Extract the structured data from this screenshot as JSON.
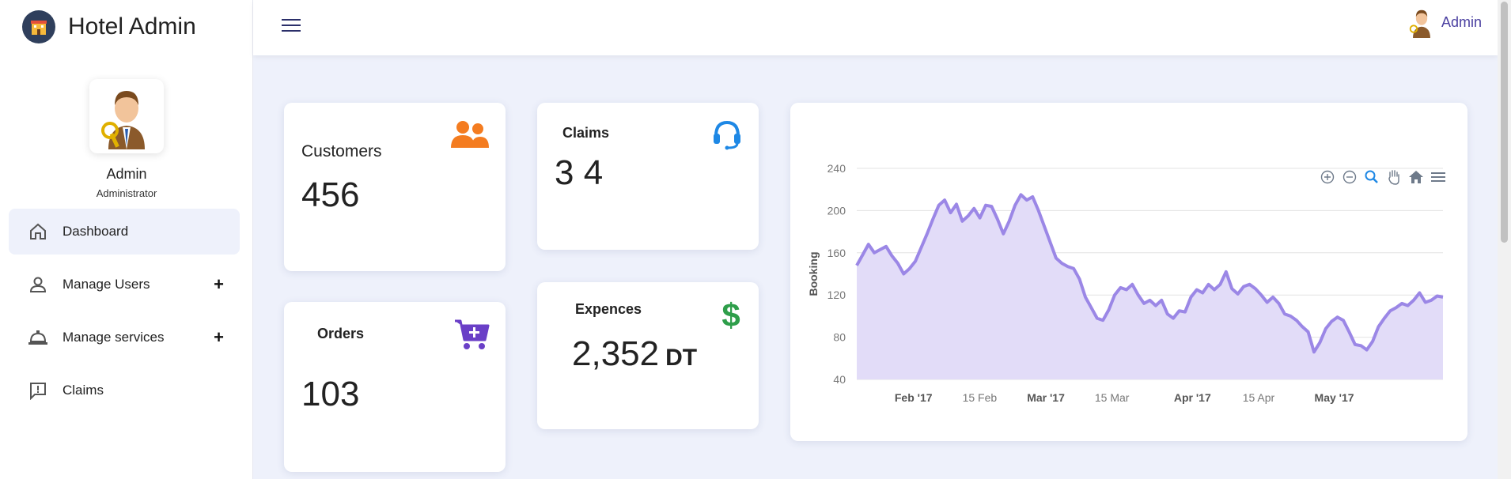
{
  "app": {
    "title": "Hotel Admin"
  },
  "profile": {
    "name": "Admin",
    "role": "Administrator"
  },
  "sidebar": {
    "items": [
      {
        "label": "Dashboard",
        "icon": "home-icon",
        "active": true,
        "expandable": false
      },
      {
        "label": "Manage Users",
        "icon": "user-icon",
        "active": false,
        "expandable": true
      },
      {
        "label": "Manage services",
        "icon": "service-bell-icon",
        "active": false,
        "expandable": true
      },
      {
        "label": "Claims",
        "icon": "alert-message-icon",
        "active": false,
        "expandable": false
      }
    ],
    "expand_symbol": "+"
  },
  "topbar": {
    "user_name": "Admin"
  },
  "cards": {
    "customers": {
      "title": "Customers",
      "value": "456",
      "icon": "users-icon",
      "icon_color": "#f47c20"
    },
    "claims": {
      "title": "Claims",
      "value": "3 4",
      "icon": "headset-icon",
      "icon_color": "#1e88e5"
    },
    "orders": {
      "title": "Orders",
      "value": "103",
      "icon": "cart-plus-icon",
      "icon_color": "#6a3fc7"
    },
    "expences": {
      "title": "Expences",
      "value": "2,352",
      "unit": "DT",
      "icon": "dollar-icon",
      "icon_color": "#2e9e4a"
    }
  },
  "colors": {
    "accent": "#9b87e6",
    "area_fill": "#e2dcf8",
    "background": "#eef1fb"
  },
  "chart_toolbar": [
    "zoom-in-icon",
    "zoom-out-icon",
    "magnifier-icon",
    "pan-hand-icon",
    "home-icon",
    "menu-icon"
  ],
  "chart_data": {
    "type": "area",
    "ylabel": "Booking",
    "ylim": [
      40,
      240
    ],
    "yticks": [
      40,
      80,
      120,
      160,
      200,
      240
    ],
    "x_tick_labels": [
      {
        "label": "Feb '17",
        "bold": true
      },
      {
        "label": "15 Feb",
        "bold": false
      },
      {
        "label": "Mar '17",
        "bold": true
      },
      {
        "label": "15 Mar",
        "bold": false
      },
      {
        "label": "Apr '17",
        "bold": true
      },
      {
        "label": "15 Apr",
        "bold": false
      },
      {
        "label": "May '17",
        "bold": true
      }
    ],
    "x_tick_days": [
      31,
      45,
      59,
      73,
      90,
      104,
      120
    ],
    "x_range_days": [
      19,
      143
    ],
    "grid": true,
    "series": [
      {
        "values": [
          148,
          158,
          168,
          160,
          163,
          166,
          157,
          150,
          140,
          145,
          152,
          165,
          178,
          192,
          205,
          210,
          198,
          206,
          190,
          195,
          202,
          193,
          205,
          204,
          192,
          178,
          190,
          205,
          215,
          210,
          213,
          200,
          185,
          170,
          155,
          150,
          147,
          145,
          135,
          118,
          108,
          98,
          96,
          106,
          120,
          127,
          125,
          130,
          120,
          112,
          115,
          110,
          115,
          102,
          98,
          105,
          104,
          118,
          125,
          122,
          130,
          125,
          130,
          142,
          126,
          121,
          128,
          130,
          126,
          120,
          113,
          118,
          112,
          102,
          100,
          96,
          90,
          85,
          66,
          75,
          88,
          95,
          99,
          96,
          85,
          73,
          72,
          68,
          76,
          90,
          98,
          105,
          108,
          112,
          110,
          115,
          122,
          113,
          115,
          119,
          118
        ]
      }
    ]
  }
}
